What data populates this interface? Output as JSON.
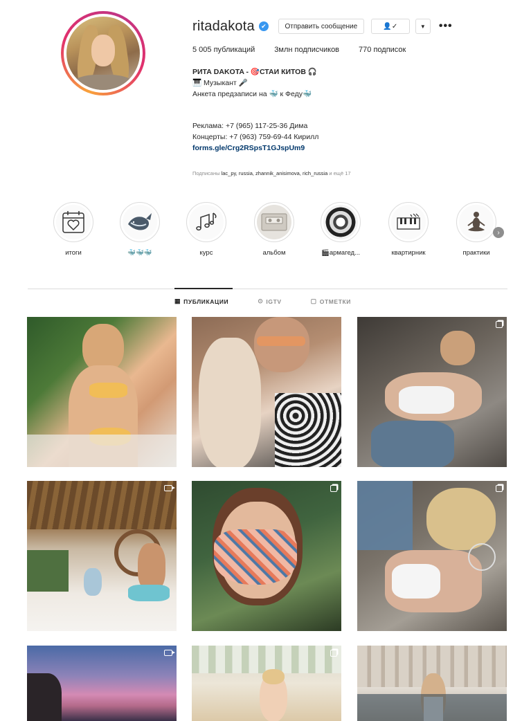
{
  "profile": {
    "username": "ritadakota",
    "message_button": "Отправить сообщение",
    "follow_button": "👤✓",
    "dropdown": "▼",
    "more": "•••",
    "verified_icon": "✔",
    "stats": {
      "posts": "5 005 публикаций",
      "followers": "3млн подписчиков",
      "following": "770 подписок"
    },
    "bio": {
      "name_line": "РИТА DAKOTA - 🎯СТАИ КИТОВ 🎧",
      "role": "🎹 Музыкант 🎤",
      "anketa": "Анкета предзаписи на 🐳 к Феду🐳",
      "ads": "Реклама: +7 (965) 117-25-36 Дима",
      "concerts": "Концерты: +7 (963) 759-69-44 Кирилл",
      "link": "forms.gle/Crg2RSpsT1GJspUm9"
    },
    "followed_by": {
      "prefix": "Подписаны ",
      "names": "lac_py, russia, zhannik_anisimova, rich_russia",
      "suffix": " и ещё 17"
    }
  },
  "highlights": [
    {
      "label": "итоги",
      "icon": "calendar-heart-icon"
    },
    {
      "label": "🐳🐳🐳",
      "icon": "whale-icon"
    },
    {
      "label": "курс",
      "icon": "music-notes-icon"
    },
    {
      "label": "альбом",
      "icon": "cassette-icon"
    },
    {
      "label": "🎬армагед...",
      "icon": "splash-photo-icon"
    },
    {
      "label": "квартирник",
      "icon": "piano-keyboard-icon"
    },
    {
      "label": "практики",
      "icon": "meditation-icon"
    }
  ],
  "highlights_next": "›",
  "tabs": [
    {
      "label": "ПУБЛИКАЦИИ",
      "icon": "▦",
      "active": true
    },
    {
      "label": "IGTV",
      "icon": "⊙",
      "active": false
    },
    {
      "label": "ОТМЕТКИ",
      "icon": "▢",
      "active": false
    }
  ],
  "posts": [
    {
      "type": "photo"
    },
    {
      "type": "photo"
    },
    {
      "type": "gallery"
    },
    {
      "type": "video"
    },
    {
      "type": "gallery"
    },
    {
      "type": "gallery"
    },
    {
      "type": "video"
    },
    {
      "type": "gallery"
    },
    {
      "type": "photo"
    }
  ]
}
